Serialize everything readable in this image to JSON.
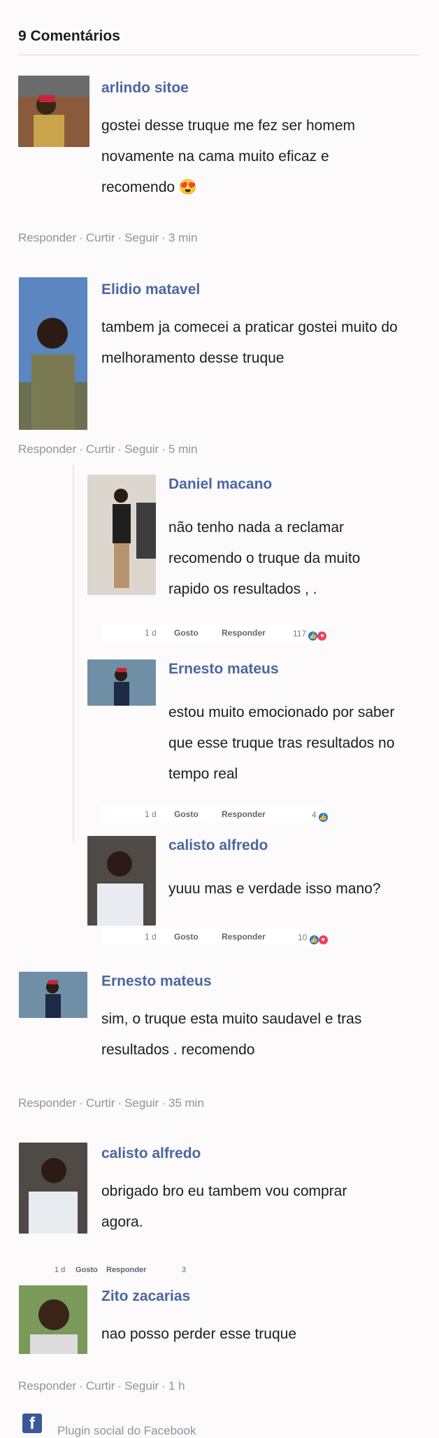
{
  "header": {
    "title": "9 Comentários"
  },
  "action_labels": {
    "reply": "Responder",
    "like": "Curtir",
    "follow": "Seguir"
  },
  "mini_labels": {
    "like": "Gosto",
    "reply": "Responder"
  },
  "comments": [
    {
      "name": "arlindo sitoe",
      "lines": [
        "gostei desse truque me fez ser homem",
        "novamente na cama muito eficaz e",
        "recomendo 😍"
      ],
      "time": "3 min"
    },
    {
      "name": "Elidio matavel",
      "lines": [
        "tambem ja comecei a praticar gostei muito do",
        "melhoramento desse truque"
      ],
      "time": "5 min"
    },
    {
      "name": "Ernesto mateus",
      "lines": [
        "sim, o truque esta muito saudavel e tras",
        "resultados . recomendo"
      ],
      "time": "35 min"
    },
    {
      "name": "calisto alfredo",
      "lines": [
        "obrigado bro  eu  tambem vou comprar",
        "agora."
      ],
      "time": ""
    },
    {
      "name": "Zito zacarias",
      "lines": [
        "nao posso perder esse truque"
      ],
      "time": "1 h"
    }
  ],
  "replies": [
    {
      "name": "Daniel macano",
      "lines": [
        "não tenho nada a reclamar",
        "recomendo o truque da muito",
        "rapido os resultados  , ."
      ],
      "age": "1 d",
      "count": "117"
    },
    {
      "name": "Ernesto mateus",
      "lines": [
        "estou muito emocionado por saber",
        "que esse truque tras resultados no",
        "tempo real"
      ],
      "age": "1 d",
      "count": "4"
    },
    {
      "name": "calisto alfredo",
      "lines": [
        "yuuu mas e verdade isso mano?"
      ],
      "age": "1 d",
      "count": "10"
    }
  ],
  "tiny_reply_row": {
    "age": "1 d",
    "count": "3"
  },
  "footer": {
    "plugin_text": "Plugin social do Facebook"
  },
  "colors": {
    "name": "#4b67a1",
    "meta": "#90949c",
    "like": "#1877f2",
    "love": "#f33e58"
  }
}
